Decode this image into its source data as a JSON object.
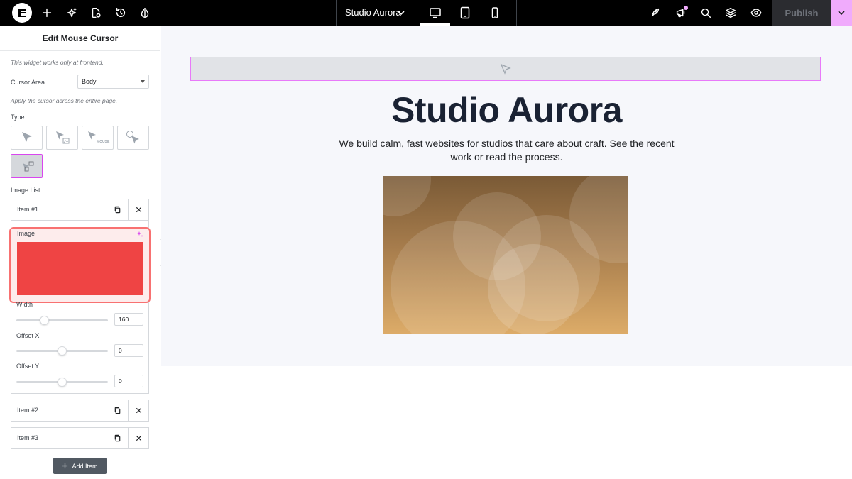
{
  "topbar": {
    "site_title": "Studio Aurora",
    "publish_label": "Publish",
    "icons": [
      "elementor-logo",
      "plus-icon",
      "ai-sparkle-icon",
      "page-settings-icon",
      "history-icon",
      "site-settings-icon",
      "site-title-chevron-icon",
      "desktop-icon",
      "tablet-icon",
      "mobile-icon",
      "rocket-icon",
      "notifications-icon",
      "search-icon",
      "layers-icon",
      "preview-eye-icon",
      "publish-chevron-icon"
    ],
    "active_device": "desktop",
    "accent_color": "#f0abfc"
  },
  "panel": {
    "title": "Edit Mouse Cursor",
    "frontend_note": "This widget works only at frontend.",
    "cursor_area_label": "Cursor Area",
    "cursor_area_value": "Body",
    "cursor_area_help": "Apply the cursor across the entire page.",
    "type_label": "Type",
    "type_options": [
      "arrow",
      "arrow-image",
      "arrow-text",
      "arrow-circle",
      "image"
    ],
    "type_mouse_text": "MOUSE",
    "selected_type": "image",
    "image_list_label": "Image List",
    "items": [
      {
        "label": "Item #1"
      },
      {
        "label": "Item #2"
      },
      {
        "label": "Item #3"
      }
    ],
    "image_label": "Image",
    "image_color": "#ef4444",
    "width_label": "Width",
    "width_value": "160",
    "offset_x_label": "Offset X",
    "offset_x_value": "0",
    "offset_y_label": "Offset Y",
    "offset_y_value": "0",
    "add_item_label": "Add Item"
  },
  "canvas": {
    "hero_title": "Studio Aurora",
    "hero_subtitle": "We build calm, fast websites for studios that care about craft. See the recent work or read the process."
  }
}
